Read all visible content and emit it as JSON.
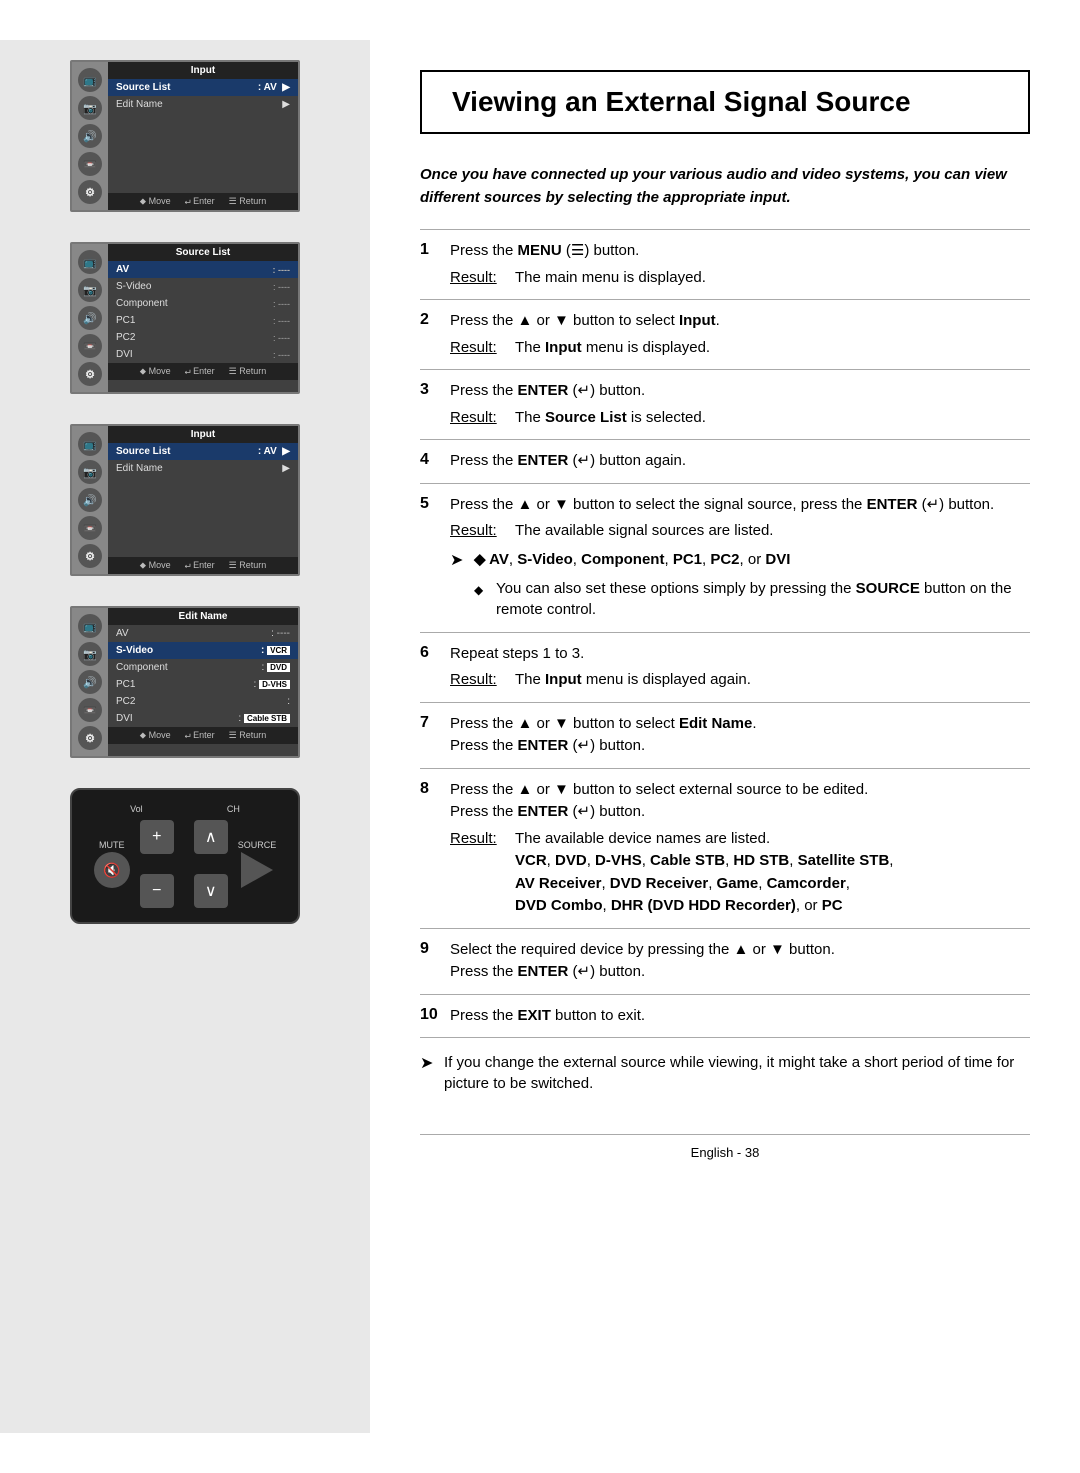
{
  "page": {
    "title": "Viewing an External Signal Source",
    "footer": "English - 38"
  },
  "intro": {
    "text": "Once you have connected up your various audio and video systems, you can view different sources by selecting the appropriate input."
  },
  "screens": {
    "screen1": {
      "title": "Input",
      "items": [
        {
          "label": "Source List",
          "value": ": AV",
          "highlight": true,
          "arrow": true
        },
        {
          "label": "Edit Name",
          "value": "",
          "highlight": false,
          "arrow": true
        }
      ],
      "footer": [
        "Move",
        "Enter",
        "Return"
      ]
    },
    "screen2": {
      "title": "Source List",
      "items": [
        {
          "label": "AV",
          "value": ": ----",
          "highlight": true
        },
        {
          "label": "S-Video",
          "value": ": ----",
          "highlight": false
        },
        {
          "label": "Component",
          "value": ": ----",
          "highlight": false
        },
        {
          "label": "PC1",
          "value": ": ----",
          "highlight": false
        },
        {
          "label": "PC2",
          "value": ": ----",
          "highlight": false
        },
        {
          "label": "DVI",
          "value": ": ----",
          "highlight": false
        }
      ],
      "footer": [
        "Move",
        "Enter",
        "Return"
      ]
    },
    "screen3": {
      "title": "Input",
      "items": [
        {
          "label": "Source List",
          "value": ": AV",
          "highlight": true,
          "arrow": true
        },
        {
          "label": "Edit Name",
          "value": "",
          "highlight": false,
          "arrow": true
        }
      ],
      "footer": [
        "Move",
        "Enter",
        "Return"
      ]
    },
    "screen4": {
      "title": "Edit Name",
      "items": [
        {
          "label": "AV",
          "value": ":",
          "tag": "----",
          "highlight": false
        },
        {
          "label": "S-Video",
          "value": ":",
          "tag": "VCR",
          "highlight": true
        },
        {
          "label": "Component",
          "value": ":",
          "tag": "DVD",
          "highlight": false
        },
        {
          "label": "PC1",
          "value": ":",
          "tag": "D-VHS",
          "highlight": false
        },
        {
          "label": "PC2",
          "value": ":",
          "tag": "",
          "highlight": false
        },
        {
          "label": "DVI",
          "value": ":",
          "tag": "Cable STB",
          "highlight": false
        }
      ],
      "footer": [
        "Move",
        "Enter",
        "Return"
      ]
    }
  },
  "icons": {
    "icon1": "📺",
    "icon2": "📷",
    "icon3": "🔊",
    "icon4": "📼",
    "icon5": "⚙"
  },
  "steps": [
    {
      "num": "1",
      "text": "Press the MENU (☰) button.",
      "result": "The main menu is displayed."
    },
    {
      "num": "2",
      "text": "Press the ▲ or ▼ button to select Input.",
      "result": "The Input menu is displayed."
    },
    {
      "num": "3",
      "text": "Press the ENTER (↵) button.",
      "result": "The Source List is selected."
    },
    {
      "num": "4",
      "text": "Press the ENTER (↵) button again.",
      "result": ""
    },
    {
      "num": "5",
      "text": "Press the ▲ or ▼ button to select the signal source, press the ENTER (↵) button.",
      "result": "The available signal sources are listed.",
      "note1": "◆ AV, S-Video, Component, PC1, PC2, or DVI",
      "note2": "◆ You can also set these options simply by pressing the SOURCE button on the remote control."
    },
    {
      "num": "6",
      "text": "Repeat steps 1 to 3.",
      "result": "The Input menu is displayed again."
    },
    {
      "num": "7",
      "text": "Press the ▲ or ▼ button to select Edit Name. Press the ENTER (↵) button.",
      "result": ""
    },
    {
      "num": "8",
      "text": "Press the ▲ or ▼ button to select external source to be edited. Press the ENTER (↵) button.",
      "result": "The available device names are listed.",
      "devices": "VCR, DVD, D-VHS, Cable STB, HD STB, Satellite STB, AV Receiver, DVD Receiver, Game, Camcorder, DVD Combo, DHR (DVD HDD Recorder), or PC"
    },
    {
      "num": "9",
      "text": "Select the required device by pressing the ▲ or ▼ button. Press the ENTER (↵) button.",
      "result": ""
    },
    {
      "num": "10",
      "text": "Press the EXIT button to exit.",
      "result": ""
    }
  ],
  "tips": [
    "If you change the external source while viewing, it might take a short period of time for picture to be switched."
  ],
  "remote": {
    "vol_label": "Vol",
    "ch_label": "CH",
    "mute_label": "MUTE",
    "source_label": "SOURCE"
  }
}
